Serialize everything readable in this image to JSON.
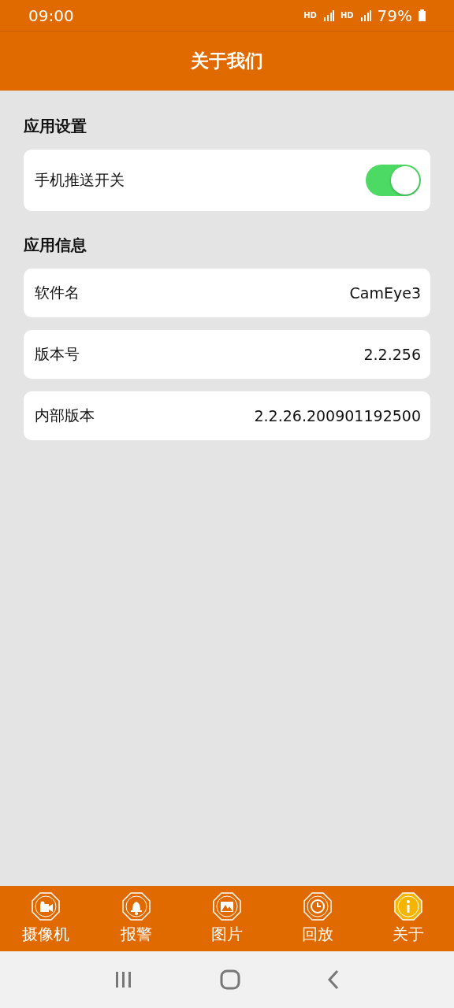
{
  "status_bar": {
    "time": "09:00",
    "network_1": "HD",
    "network_2": "HD",
    "battery": "79%"
  },
  "header": {
    "title": "关于我们"
  },
  "sections": [
    {
      "title": "应用设置",
      "rows": [
        {
          "kind": "toggle",
          "label": "手机推送开关",
          "on": true
        }
      ]
    },
    {
      "title": "应用信息",
      "rows": [
        {
          "kind": "info",
          "label": "软件名",
          "value": "CamEye3"
        },
        {
          "kind": "info",
          "label": "版本号",
          "value": "2.2.256"
        },
        {
          "kind": "info",
          "label": "内部版本",
          "value": "2.2.26.200901192500"
        }
      ]
    }
  ],
  "tabs": [
    {
      "kind": "camera",
      "label": "摄像机",
      "selected": false
    },
    {
      "kind": "bell",
      "label": "报警",
      "selected": false
    },
    {
      "kind": "image",
      "label": "图片",
      "selected": false
    },
    {
      "kind": "history",
      "label": "回放",
      "selected": false
    },
    {
      "kind": "info",
      "label": "关于",
      "selected": true
    }
  ]
}
